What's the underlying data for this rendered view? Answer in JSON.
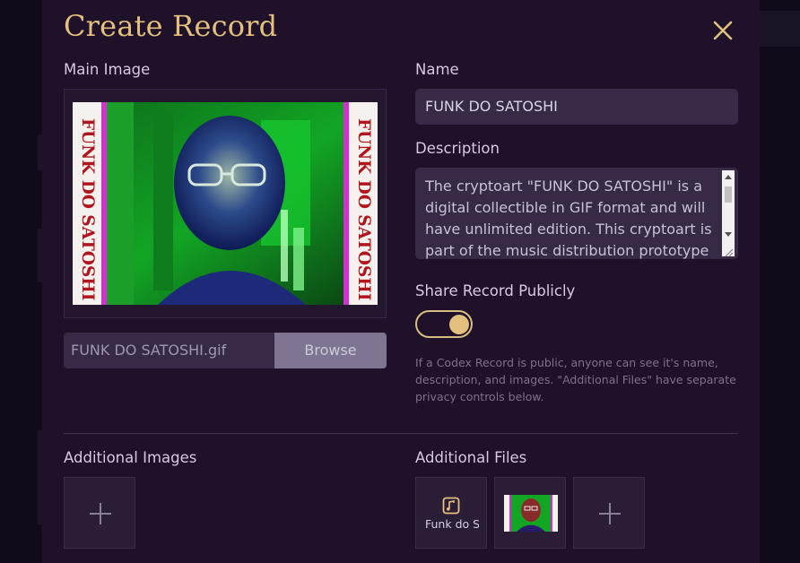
{
  "modal": {
    "title": "Create Record",
    "close_icon": "close-icon"
  },
  "main_image": {
    "label": "Main Image",
    "preview_text": "FUNK DO SATOSHI",
    "file_name": "FUNK DO SATOSHI.gif",
    "browse_label": "Browse"
  },
  "name": {
    "label": "Name",
    "value": "FUNK DO SATOSHI"
  },
  "description": {
    "label": "Description",
    "value": "The cryptoart \"FUNK DO SATOSHI\" is a digital collectible in GIF format and will have unlimited edition. This cryptoart is part of the music distribution prototype"
  },
  "share": {
    "label": "Share Record Publicly",
    "enabled": true,
    "hint": "If a Codex Record is public, anyone can see it's name, description, and images. \"Additional Files\" have separate privacy controls below."
  },
  "additional_images": {
    "label": "Additional Images",
    "add_icon": "plus-icon"
  },
  "additional_files": {
    "label": "Additional Files",
    "items": [
      {
        "icon": "music-file-icon",
        "label": "Funk do S"
      },
      {
        "icon": "image-thumbnail",
        "label": ""
      }
    ],
    "add_icon": "plus-icon"
  },
  "colors": {
    "accent_gold": "#e3c07d",
    "modal_bg": "#1e1129",
    "field_bg": "#362a47",
    "browse_bg": "#7f7592"
  }
}
